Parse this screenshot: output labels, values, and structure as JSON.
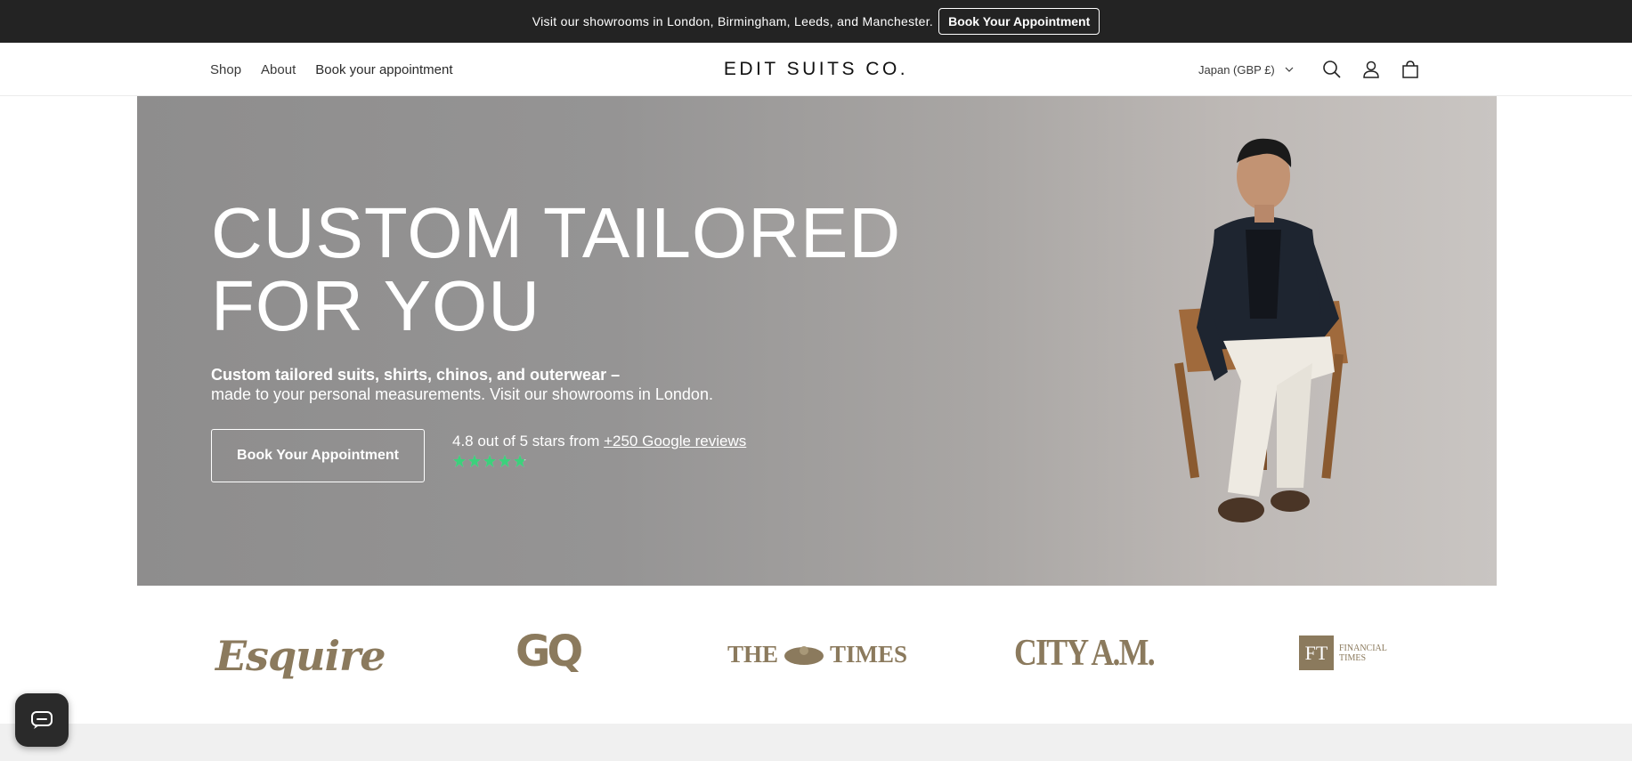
{
  "announcement": {
    "text": "Visit our showrooms in London, Birmingham, Leeds, and Manchester.",
    "button_label": "Book Your Appointment"
  },
  "header": {
    "nav": [
      {
        "label": "Shop"
      },
      {
        "label": "About"
      },
      {
        "label": "Book your appointment"
      }
    ],
    "logo": "EDIT SUITS CO.",
    "currency": "Japan (GBP £)",
    "icons": [
      "search-icon",
      "account-icon",
      "cart-icon"
    ]
  },
  "hero": {
    "title_line1": "CUSTOM TAILORED",
    "title_line2": "FOR YOU",
    "subtitle_bold": "Custom tailored suits, shirts, chinos, and outerwear –",
    "subtitle_rest": "made to your personal measurements. Visit our showrooms in London.",
    "button_label": "Book Your Appointment",
    "rating_text": "4.8 out of 5 stars from",
    "rating_link": "+250 Google reviews",
    "rating_value": 4.8,
    "rating_max": 5,
    "star_color": "#3dd07c"
  },
  "press": {
    "logos": [
      "Esquire",
      "GQ",
      "THE",
      "TIMES",
      "CITY A.M.",
      "FT",
      "FINANCIAL",
      "TIMES"
    ]
  },
  "colors": {
    "announcement_bg": "#232323",
    "press_logo": "#8b7a5d"
  },
  "chat": {
    "icon": "chat-icon"
  }
}
